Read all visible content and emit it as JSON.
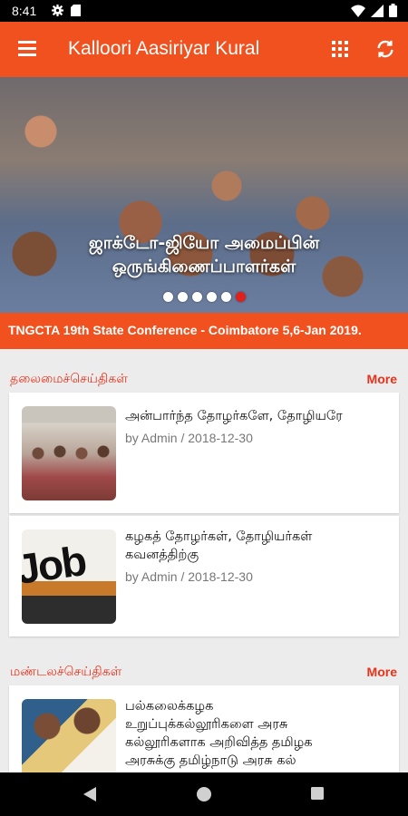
{
  "status_bar": {
    "time": "8:41",
    "icons": [
      "gear-icon",
      "sd-card-icon",
      "wifi-icon",
      "signal-icon",
      "battery-icon"
    ]
  },
  "app_bar": {
    "title": "Kalloori Aasiriyar Kural",
    "icons": [
      "menu-icon",
      "grid-icon",
      "refresh-icon"
    ]
  },
  "banner": {
    "caption_line1": "ஜாக்டோ-ஜியோ அமைப்பின்",
    "caption_line2": "ஒருங்கிணைப்பாளர்கள்",
    "slide_count": 6,
    "active_slide": 6
  },
  "ticker": {
    "text": "TNGCTA 19th State Conference - Coimbatore 5,6-Jan 2019."
  },
  "sections": [
    {
      "label": "தலைமைச்செய்திகள்",
      "more": "More",
      "items": [
        {
          "title": "அன்பார்ந்த தோழர்களே, தோழியரே",
          "meta": "by Admin / 2018-12-30"
        },
        {
          "title_line1": "கழகத் தோழர்கள், தோழியர்கள்",
          "title_line2": "கவனத்திற்கு",
          "meta": "by Admin / 2018-12-30",
          "thumb_text": "Job"
        }
      ]
    },
    {
      "label": "மண்டலச்செய்திகள்",
      "more": "More",
      "items": [
        {
          "title_line1": "பல்கலைக்கழக",
          "title_line2": "உறுப்புக்கல்லூரிகளை அரசு",
          "title_line3": "கல்லூரிகளாக அறிவித்த தமிழக",
          "title_line4": "அரசுக்கு தமிழ்நாடு அரசு கல்"
        }
      ]
    }
  ],
  "colors": {
    "primary": "#f0511e",
    "accent": "#e8321b",
    "background": "#ececec"
  }
}
